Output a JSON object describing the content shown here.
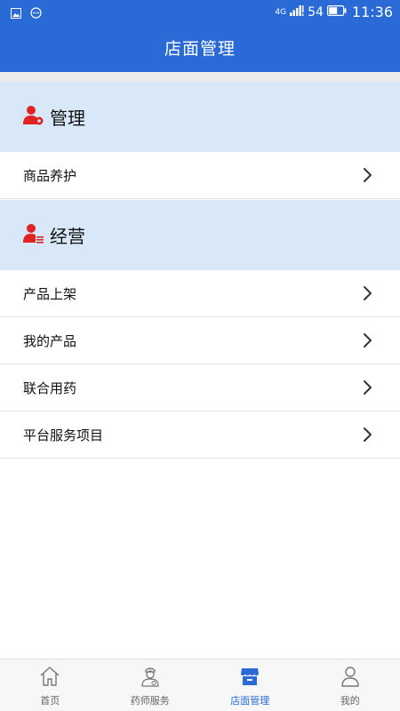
{
  "status_bar": {
    "network": "4G",
    "battery": "54",
    "time": "11:36"
  },
  "nav": {
    "title": "店面管理"
  },
  "sections": [
    {
      "title": "管理",
      "icon": "user-gear-icon",
      "items": [
        {
          "label": "商品养护"
        }
      ]
    },
    {
      "title": "经营",
      "icon": "user-list-icon",
      "items": [
        {
          "label": "产品上架"
        },
        {
          "label": "我的产品"
        },
        {
          "label": "联合用药"
        },
        {
          "label": "平台服务项目"
        }
      ]
    }
  ],
  "tabs": [
    {
      "label": "首页",
      "icon": "home-icon",
      "active": false
    },
    {
      "label": "药师服务",
      "icon": "pharmacist-icon",
      "active": false
    },
    {
      "label": "店面管理",
      "icon": "store-icon",
      "active": true
    },
    {
      "label": "我的",
      "icon": "profile-icon",
      "active": false
    }
  ],
  "colors": {
    "primary": "#2a6ad6",
    "section_bg": "#d8e8f8",
    "icon_red": "#e02424"
  }
}
